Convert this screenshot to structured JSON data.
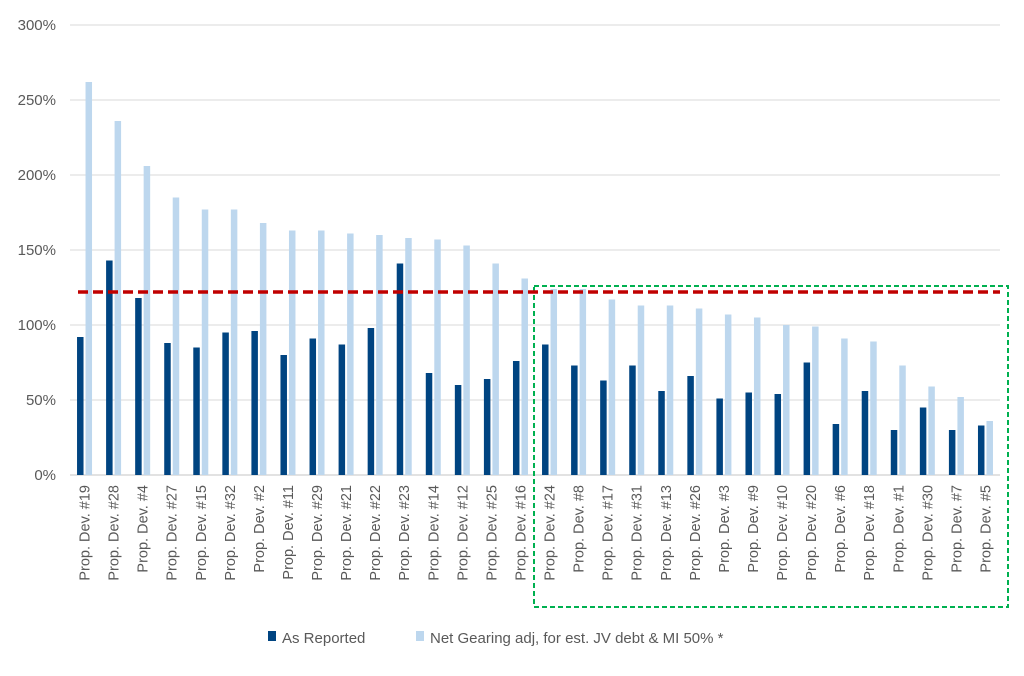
{
  "chart_data": {
    "type": "bar",
    "title": "",
    "xlabel": "",
    "ylabel": "",
    "ylim": [
      0,
      300
    ],
    "y_ticks": [
      "0%",
      "50%",
      "100%",
      "150%",
      "200%",
      "250%",
      "300%"
    ],
    "grid": true,
    "legend_position": "bottom",
    "categories": [
      "Prop. Dev. #19",
      "Prop. Dev. #28",
      "Prop. Dev. #4",
      "Prop. Dev. #27",
      "Prop. Dev. #15",
      "Prop. Dev. #32",
      "Prop. Dev. #2",
      "Prop. Dev. #11",
      "Prop. Dev. #29",
      "Prop. Dev. #21",
      "Prop. Dev. #22",
      "Prop. Dev. #23",
      "Prop. Dev. #14",
      "Prop. Dev. #12",
      "Prop. Dev. #25",
      "Prop. Dev. #16",
      "Prop. Dev. #24",
      "Prop. Dev. #8",
      "Prop. Dev. #17",
      "Prop. Dev. #31",
      "Prop. Dev. #13",
      "Prop. Dev. #26",
      "Prop. Dev. #3",
      "Prop. Dev. #9",
      "Prop. Dev. #10",
      "Prop. Dev. #20",
      "Prop. Dev. #6",
      "Prop. Dev. #18",
      "Prop. Dev. #1",
      "Prop. Dev. #30",
      "Prop. Dev. #7",
      "Prop. Dev. #5"
    ],
    "series": [
      {
        "name": "As Reported",
        "color": "#004481",
        "values": [
          92,
          143,
          118,
          88,
          85,
          95,
          96,
          80,
          91,
          87,
          98,
          141,
          68,
          60,
          64,
          76,
          87,
          73,
          63,
          73,
          56,
          66,
          51,
          55,
          54,
          75,
          34,
          56,
          30,
          45,
          30,
          33
        ]
      },
      {
        "name": "Net Gearing adj, for est. JV debt & MI 50% *",
        "color": "#bdd7ee",
        "values": [
          262,
          236,
          206,
          185,
          177,
          177,
          168,
          163,
          163,
          161,
          160,
          158,
          157,
          153,
          141,
          131,
          124,
          124,
          117,
          113,
          113,
          111,
          107,
          105,
          100,
          99,
          91,
          89,
          73,
          59,
          52,
          36
        ]
      }
    ],
    "reference_line": {
      "value": 122,
      "color": "#c00000",
      "style": "dashed"
    },
    "highlight_box": {
      "from_category": "Prop. Dev. #24",
      "to_category": "Prop. Dev. #5",
      "color": "#00b050",
      "style": "dashed"
    }
  }
}
